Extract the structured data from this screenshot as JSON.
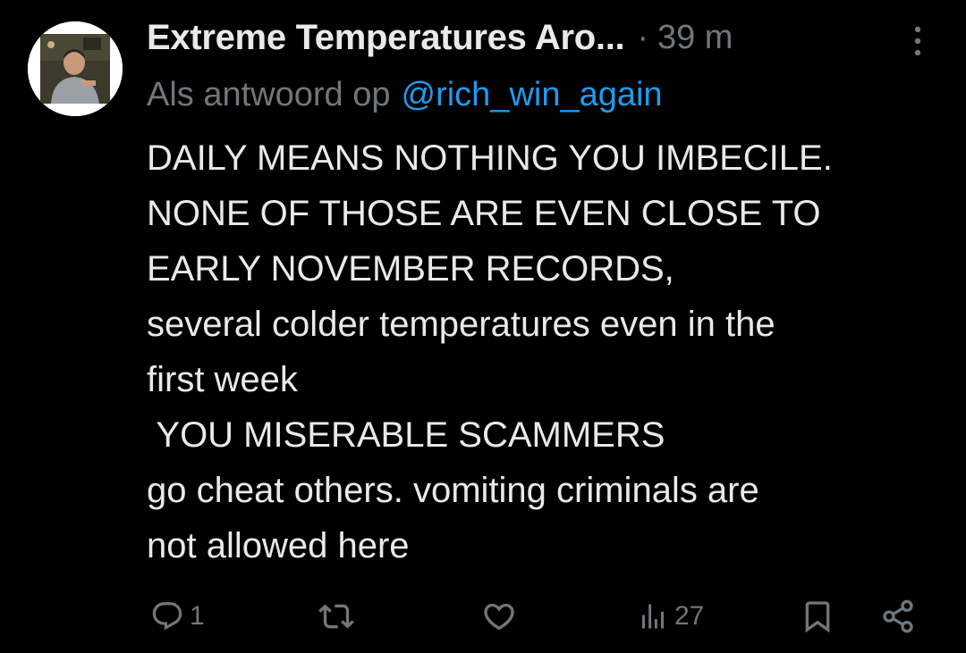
{
  "tweet": {
    "display_name": "Extreme Temperatures Aro...",
    "separator": "·",
    "time_ago": "39 m",
    "reply_prefix": "Als antwoord op",
    "reply_to": "@rich_win_again",
    "lines": [
      "DAILY MEANS NOTHING YOU IMBECILE.",
      "NONE OF THOSE ARE EVEN CLOSE TO",
      "EARLY NOVEMBER RECORDS,",
      "several colder temperatures even in the",
      "first week",
      " YOU MISERABLE SCAMMERS",
      "go cheat others. vomiting criminals are",
      "not allowed here"
    ]
  },
  "actions": {
    "reply_count": "1",
    "repost_count": "",
    "like_count": "",
    "views_count": "27"
  },
  "icons": {
    "more": "more-dots-icon",
    "reply": "reply-icon",
    "repost": "repost-icon",
    "like": "heart-icon",
    "views": "views-icon",
    "bookmark": "bookmark-icon",
    "share": "share-icon"
  },
  "colors": {
    "background": "#000000",
    "text": "#e7e9ea",
    "muted": "#71767b",
    "link": "#1d9bf0"
  }
}
